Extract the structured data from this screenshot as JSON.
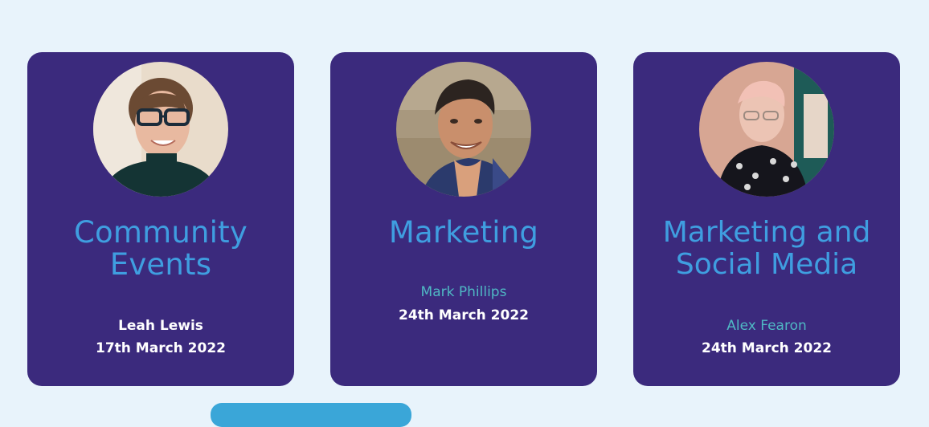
{
  "cards": [
    {
      "title_line1": "Community",
      "title_line2": "Events",
      "presenter": "Leah Lewis",
      "date": "17th March 2022"
    },
    {
      "title_line1": "Marketing",
      "title_line2": "",
      "presenter": "Mark Phillips",
      "date": "24th March 2022"
    },
    {
      "title_line1": "Marketing and",
      "title_line2": "Social Media",
      "presenter": "Alex Fearon",
      "date": "24th March 2022"
    }
  ],
  "colors": {
    "page_background": "#e8f3fb",
    "card_background": "#3b2a7d",
    "title": "#3f9ee0",
    "presenter_highlight": "#4fb8c4",
    "text_white": "#ffffff",
    "button": "#3aa6d8"
  }
}
